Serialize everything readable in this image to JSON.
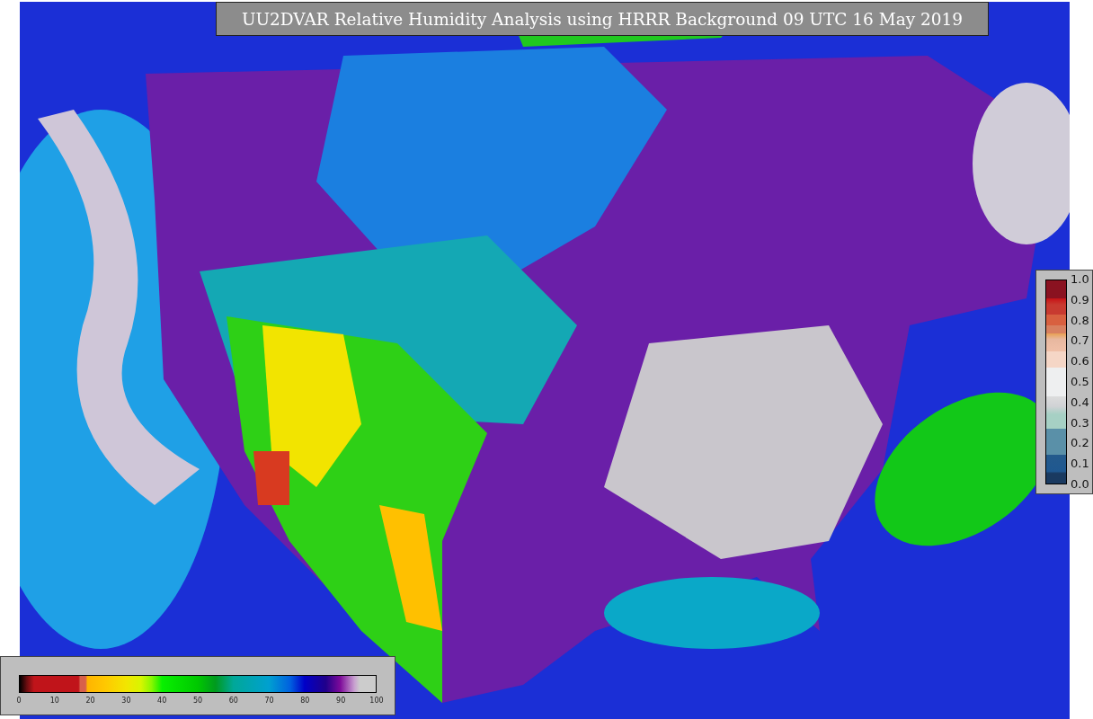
{
  "title": "UU2DVAR Relative Humidity Analysis using HRRR Background 09 UTC 16 May 2019",
  "humidity_colorbar": {
    "ticks": [
      "0",
      "10",
      "20",
      "30",
      "40",
      "50",
      "60",
      "70",
      "80",
      "90",
      "100"
    ]
  },
  "observation_colorbar": {
    "ticks": [
      "1.0",
      "0.9",
      "0.8",
      "0.7",
      "0.6",
      "0.5",
      "0.4",
      "0.3",
      "0.2",
      "0.1",
      "0.0"
    ]
  }
}
